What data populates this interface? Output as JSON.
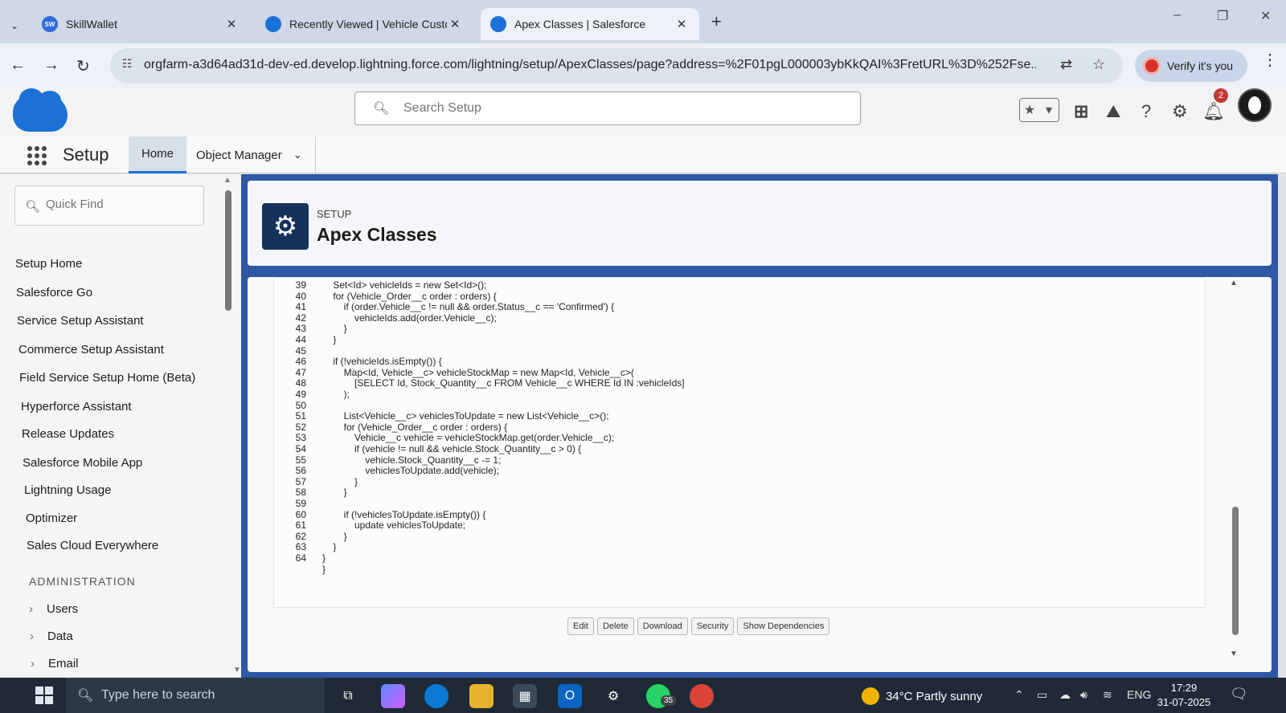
{
  "browser": {
    "tabs": [
      {
        "title": "SkillWallet",
        "favicon_text": "SW"
      },
      {
        "title": "Recently Viewed | Vehicle Custo"
      },
      {
        "title": "Apex Classes | Salesforce"
      }
    ],
    "url": "orgfarm-a3d64ad31d-dev-ed.develop.lightning.force.com/lightning/setup/ApexClasses/page?address=%2F01pgL000003ybKkQAI%3FretURL%3D%252Fse...",
    "verify_label": "Verify it's you"
  },
  "header": {
    "search_placeholder": "Search Setup",
    "notification_count": "2"
  },
  "navbar": {
    "app_name": "Setup",
    "tabs": [
      "Home",
      "Object Manager"
    ]
  },
  "sidebar": {
    "quick_find_placeholder": "Quick Find",
    "items": [
      "Setup Home",
      "Salesforce Go",
      "Service Setup Assistant",
      "Commerce Setup Assistant",
      "Field Service Setup Home (Beta)",
      "Hyperforce Assistant",
      "Release Updates",
      "Salesforce Mobile App",
      "Lightning Usage",
      "Optimizer",
      "Sales Cloud Everywhere"
    ],
    "section_heading": "ADMINISTRATION",
    "tree_items": [
      "Users",
      "Data",
      "Email"
    ]
  },
  "page": {
    "eyebrow": "SETUP",
    "title": "Apex Classes"
  },
  "code": {
    "lines": [
      {
        "n": "39",
        "t": "    Set<Id> vehicleIds = new Set<Id>();"
      },
      {
        "n": "40",
        "t": "    for (Vehicle_Order__c order : orders) {"
      },
      {
        "n": "41",
        "t": "        if (order.Vehicle__c != null && order.Status__c == 'Confirmed') {"
      },
      {
        "n": "42",
        "t": "            vehicleIds.add(order.Vehicle__c);"
      },
      {
        "n": "43",
        "t": "        }"
      },
      {
        "n": "44",
        "t": "    }"
      },
      {
        "n": "45",
        "t": ""
      },
      {
        "n": "46",
        "t": "    if (!vehicleIds.isEmpty()) {"
      },
      {
        "n": "47",
        "t": "        Map<Id, Vehicle__c> vehicleStockMap = new Map<Id, Vehicle__c>("
      },
      {
        "n": "48",
        "t": "            [SELECT Id, Stock_Quantity__c FROM Vehicle__c WHERE Id IN :vehicleIds]"
      },
      {
        "n": "49",
        "t": "        );"
      },
      {
        "n": "50",
        "t": ""
      },
      {
        "n": "51",
        "t": "        List<Vehicle__c> vehiclesToUpdate = new List<Vehicle__c>();"
      },
      {
        "n": "52",
        "t": "        for (Vehicle_Order__c order : orders) {"
      },
      {
        "n": "53",
        "t": "            Vehicle__c vehicle = vehicleStockMap.get(order.Vehicle__c);"
      },
      {
        "n": "54",
        "t": "            if (vehicle != null && vehicle.Stock_Quantity__c > 0) {"
      },
      {
        "n": "55",
        "t": "                vehicle.Stock_Quantity__c -= 1;"
      },
      {
        "n": "56",
        "t": "                vehiclesToUpdate.add(vehicle);"
      },
      {
        "n": "57",
        "t": "            }"
      },
      {
        "n": "58",
        "t": "        }"
      },
      {
        "n": "59",
        "t": ""
      },
      {
        "n": "60",
        "t": "        if (!vehiclesToUpdate.isEmpty()) {"
      },
      {
        "n": "61",
        "t": "            update vehiclesToUpdate;"
      },
      {
        "n": "62",
        "t": "        }"
      },
      {
        "n": "63",
        "t": "    }"
      },
      {
        "n": "64",
        "t": "}"
      },
      {
        "n": "",
        "t": "}"
      }
    ],
    "buttons": [
      "Edit",
      "Delete",
      "Download",
      "Security",
      "Show Dependencies"
    ]
  },
  "taskbar": {
    "search_placeholder": "Type here to search",
    "whatsapp_badge": "35",
    "weather": "34°C  Partly sunny",
    "language": "ENG",
    "time": "17:29",
    "date": "31-07-2025"
  },
  "colors": {
    "brand_blue": "#1b71d8",
    "setup_banner": "#2e58a4",
    "gear_box": "#16325c",
    "taskbar": "#1f2a36"
  }
}
